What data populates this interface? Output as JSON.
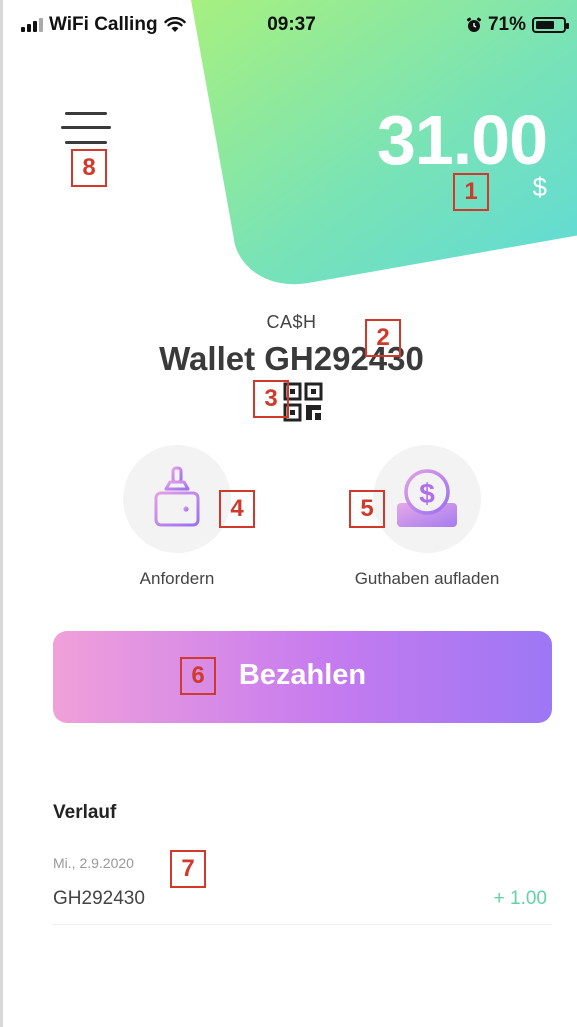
{
  "status_bar": {
    "carrier": "WiFi Calling",
    "time": "09:37",
    "battery_percent": "71%",
    "battery_level": 0.71
  },
  "header": {
    "menu_icon": "hamburger-menu-icon",
    "balance": "31.00",
    "currency": "$"
  },
  "wallet": {
    "type_label": "CA$H",
    "name": "Wallet GH292430",
    "qr_icon": "qr-code-icon"
  },
  "actions": [
    {
      "label": "Anfordern",
      "icon": "request-icon"
    },
    {
      "label": "Guthaben aufladen",
      "icon": "top-up-coin-icon"
    }
  ],
  "pay_button": {
    "label": "Bezahlen"
  },
  "history": {
    "title": "Verlauf",
    "transactions": [
      {
        "date": "Mi., 2.9.2020",
        "id": "GH292430",
        "amount": "+ 1.00"
      }
    ]
  },
  "annotations": [
    "1",
    "2",
    "3",
    "4",
    "5",
    "6",
    "7",
    "8"
  ],
  "colors": {
    "accent_green_start": "#a7f07f",
    "accent_green_end": "#5fdad8",
    "pay_gradient_start": "#f0a0da",
    "pay_gradient_end": "#9d77f5",
    "icon_purple": "#b86ee8",
    "positive_amount": "#62d3a4",
    "annotation_red": "#d03a2c"
  }
}
